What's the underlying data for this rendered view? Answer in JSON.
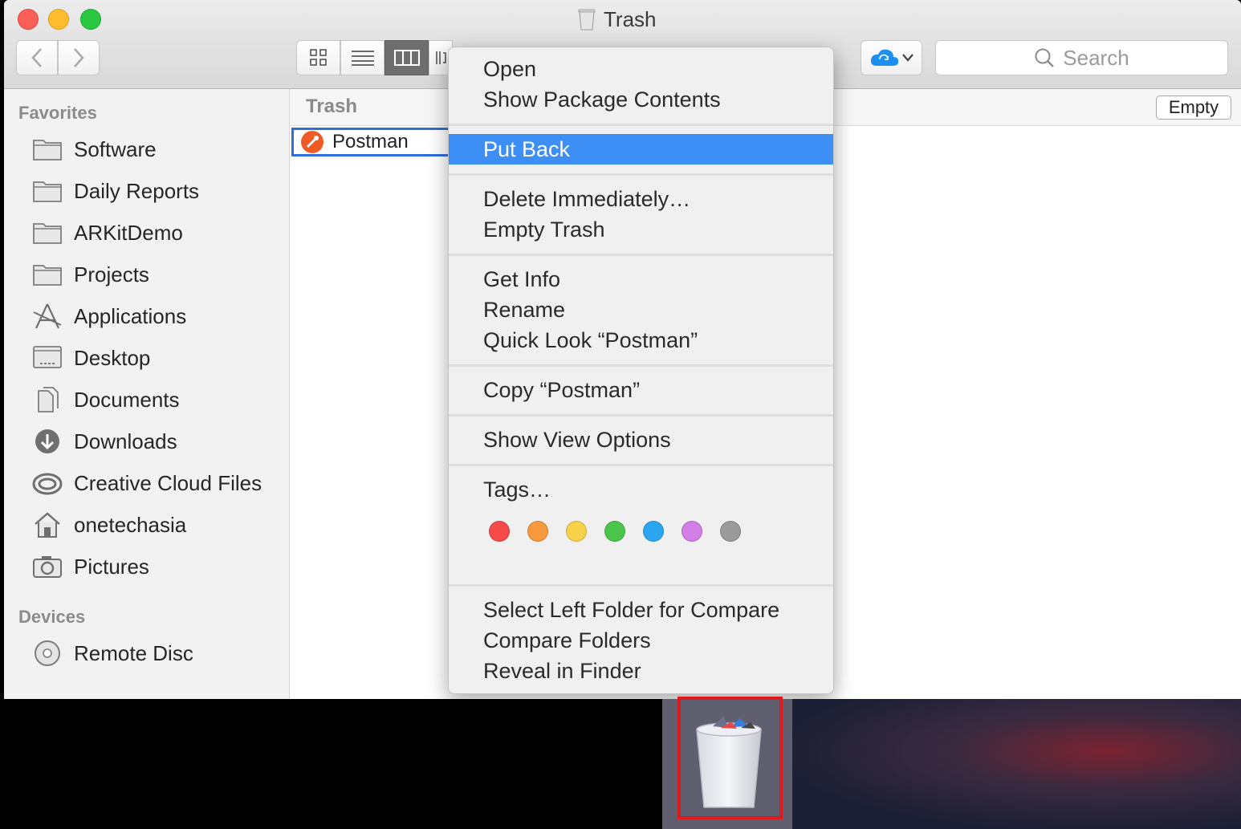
{
  "window": {
    "title": "Trash"
  },
  "toolbar": {
    "search_placeholder": "Search"
  },
  "sidebar": {
    "favorites_heading": "Favorites",
    "favorites": [
      {
        "label": "Software",
        "icon": "folder-icon"
      },
      {
        "label": "Daily Reports",
        "icon": "folder-icon"
      },
      {
        "label": "ARKitDemo",
        "icon": "folder-icon"
      },
      {
        "label": "Projects",
        "icon": "folder-icon"
      },
      {
        "label": "Applications",
        "icon": "applications-icon"
      },
      {
        "label": "Desktop",
        "icon": "desktop-icon"
      },
      {
        "label": "Documents",
        "icon": "documents-icon"
      },
      {
        "label": "Downloads",
        "icon": "downloads-icon"
      },
      {
        "label": "Creative Cloud Files",
        "icon": "creative-cloud-icon"
      },
      {
        "label": "onetechasia",
        "icon": "home-icon"
      },
      {
        "label": "Pictures",
        "icon": "camera-icon"
      }
    ],
    "devices_heading": "Devices",
    "devices": [
      {
        "label": "Remote Disc",
        "icon": "disc-icon"
      }
    ]
  },
  "content": {
    "column_title": "Trash",
    "empty_button": "Empty",
    "files": [
      {
        "name": "Postman",
        "icon": "postman-icon"
      }
    ]
  },
  "context_menu": {
    "items": [
      "Open",
      "Show Package Contents",
      "Put Back",
      "Delete Immediately…",
      "Empty Trash",
      "Get Info",
      "Rename",
      "Quick Look “Postman”",
      "Copy “Postman”",
      "Show View Options",
      "Tags…",
      "Select Left Folder for Compare",
      "Compare Folders",
      "Reveal in Finder"
    ],
    "highlighted": "Put Back",
    "tag_colors": [
      "#f64b4b",
      "#f79a3e",
      "#f7d14a",
      "#4cc54c",
      "#2aa7f0",
      "#d27ee6",
      "#9b9b9b"
    ]
  },
  "colors": {
    "selection": "#3d8ef5",
    "highlight_box": "#e0191e"
  }
}
